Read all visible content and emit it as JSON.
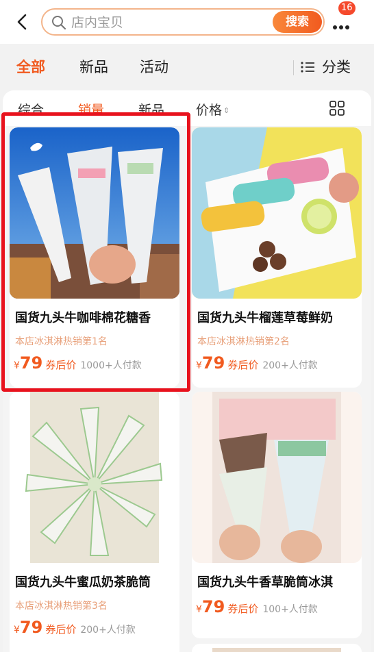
{
  "search": {
    "placeholder": "店内宝贝",
    "button_label": "搜索"
  },
  "header": {
    "badge_count": "16"
  },
  "tabs": [
    {
      "label": "全部",
      "active": true
    },
    {
      "label": "新品",
      "active": false
    },
    {
      "label": "活动",
      "active": false
    }
  ],
  "category_label": "分类",
  "sort_options": [
    {
      "label": "综合",
      "active": false
    },
    {
      "label": "销量",
      "active": true
    },
    {
      "label": "新品",
      "active": false
    },
    {
      "label": "价格",
      "active": false
    }
  ],
  "products": [
    {
      "title": "国货九头牛咖啡棉花糖香",
      "rank": "本店冰淇淋热销第1名",
      "currency": "¥",
      "price": "79",
      "coupon": "券后价",
      "buyers": "1000+人付款"
    },
    {
      "title": "国货九头牛榴莲草莓鲜奶",
      "rank": "本店冰淇淋热销第2名",
      "currency": "¥",
      "price": "79",
      "coupon": "券后价",
      "buyers": "200+人付款"
    },
    {
      "title": "国货九头牛蜜瓜奶茶脆筒",
      "rank": "本店冰淇淋热销第3名",
      "currency": "¥",
      "price": "79",
      "coupon": "券后价",
      "buyers": "200+人付款"
    },
    {
      "title": "国货九头牛香草脆筒冰淇",
      "rank": "",
      "currency": "¥",
      "price": "79",
      "coupon": "券后价",
      "buyers": "100+人付款"
    }
  ],
  "colors": {
    "accent": "#f15a1f",
    "highlight": "#e8121d"
  }
}
